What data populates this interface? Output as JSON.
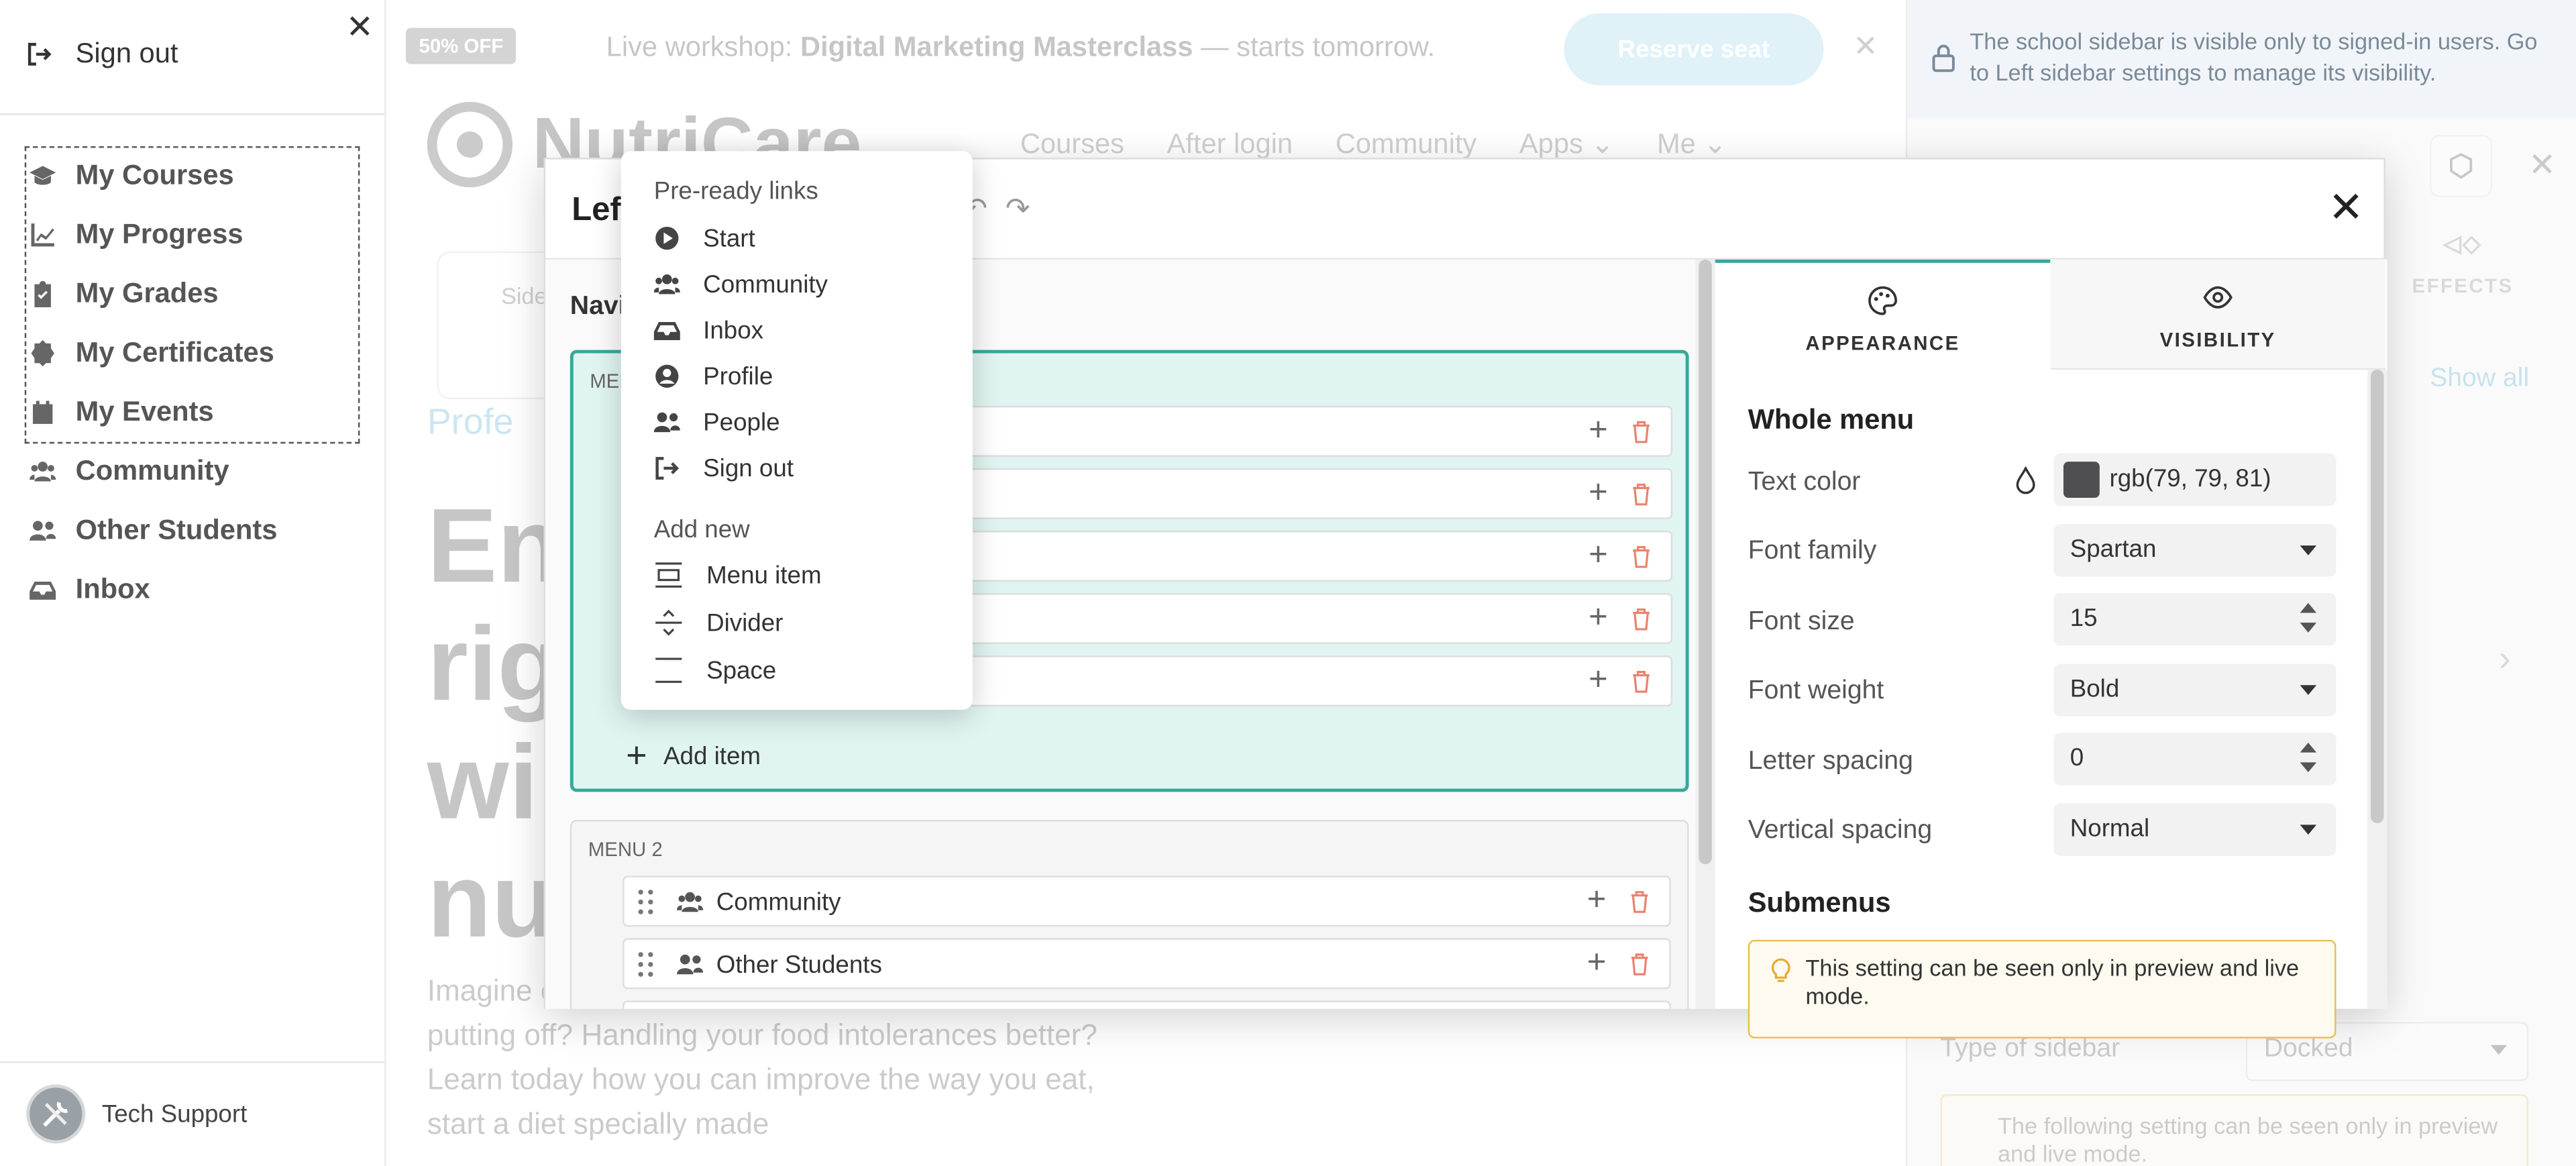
{
  "sidebar": {
    "sign_out": "Sign out",
    "items": [
      {
        "label": "My Courses",
        "icon": "graduation-cap-icon"
      },
      {
        "label": "My Progress",
        "icon": "chart-line-icon"
      },
      {
        "label": "My Grades",
        "icon": "clipboard-check-icon"
      },
      {
        "label": "My Certificates",
        "icon": "certificate-icon"
      },
      {
        "label": "My Events",
        "icon": "calendar-icon"
      },
      {
        "label": "Community",
        "icon": "users-icon"
      },
      {
        "label": "Other Students",
        "icon": "user-friends-icon"
      },
      {
        "label": "Inbox",
        "icon": "inbox-icon"
      }
    ],
    "support": "Tech Support"
  },
  "promo": {
    "badge": "50% OFF",
    "text_prefix": "Live workshop: ",
    "text_bold": "Digital Marketing Masterclass",
    "text_suffix": " — starts tomorrow.",
    "button": "Reserve seat"
  },
  "page": {
    "brand": "NutriCare",
    "nav": [
      "Courses",
      "After login",
      "Community",
      "Apps",
      "Me"
    ],
    "card_label": "Side",
    "subtitle": "Profe",
    "hero_lines": [
      "En",
      "rig",
      "wi",
      "nu"
    ],
    "paragraph": "Imagine energy? Running the marathon you've been putting off? Handling your food intolerances better? Learn today how you can improve the way you eat, start a diet specially made"
  },
  "right_panel": {
    "notice": "The school sidebar is visible only to signed-in users. Go to Left sidebar settings to manage its visibility.",
    "effects": "EFFECTS",
    "show_all": "Show all",
    "type_label": "Type of sidebar",
    "type_value": "Docked",
    "tip": "The following setting can be seen only in preview and live mode."
  },
  "modal": {
    "title": "Left",
    "nav_label": "Navi",
    "menu1_label": "MEN",
    "add_item": "Add item",
    "menu2_label": "MENU 2",
    "menu2_items": [
      {
        "label": "Community"
      },
      {
        "label": "Other Students"
      }
    ],
    "tabs": {
      "appearance": "APPEARANCE",
      "visibility": "VISIBILITY"
    },
    "whole_menu": "Whole menu",
    "fields": {
      "text_color_label": "Text color",
      "text_color_value": "rgb(79, 79, 81)",
      "font_family_label": "Font family",
      "font_family_value": "Spartan",
      "font_size_label": "Font size",
      "font_size_value": "15",
      "font_weight_label": "Font weight",
      "font_weight_value": "Bold",
      "letter_spacing_label": "Letter spacing",
      "letter_spacing_value": "0",
      "vertical_spacing_label": "Vertical spacing",
      "vertical_spacing_value": "Normal"
    },
    "submenus": "Submenus",
    "tip": "This setting can be seen only in preview and live mode."
  },
  "popup": {
    "preready_header": "Pre-ready links",
    "preready": [
      {
        "label": "Start",
        "icon": "play-circle-icon"
      },
      {
        "label": "Community",
        "icon": "users-icon"
      },
      {
        "label": "Inbox",
        "icon": "inbox-icon"
      },
      {
        "label": "Profile",
        "icon": "user-circle-icon"
      },
      {
        "label": "People",
        "icon": "user-friends-icon"
      },
      {
        "label": "Sign out",
        "icon": "sign-out-icon"
      }
    ],
    "addnew_header": "Add new",
    "addnew": [
      {
        "label": "Menu item",
        "icon": "menu-item-icon"
      },
      {
        "label": "Divider",
        "icon": "divider-icon"
      },
      {
        "label": "Space",
        "icon": "space-icon"
      }
    ]
  },
  "colors": {
    "accent": "#36a89a",
    "menu_bg": "#e0f5f1",
    "link": "#4aa6d0",
    "trash": "#e8836f",
    "tip_border": "#e8c04d"
  }
}
